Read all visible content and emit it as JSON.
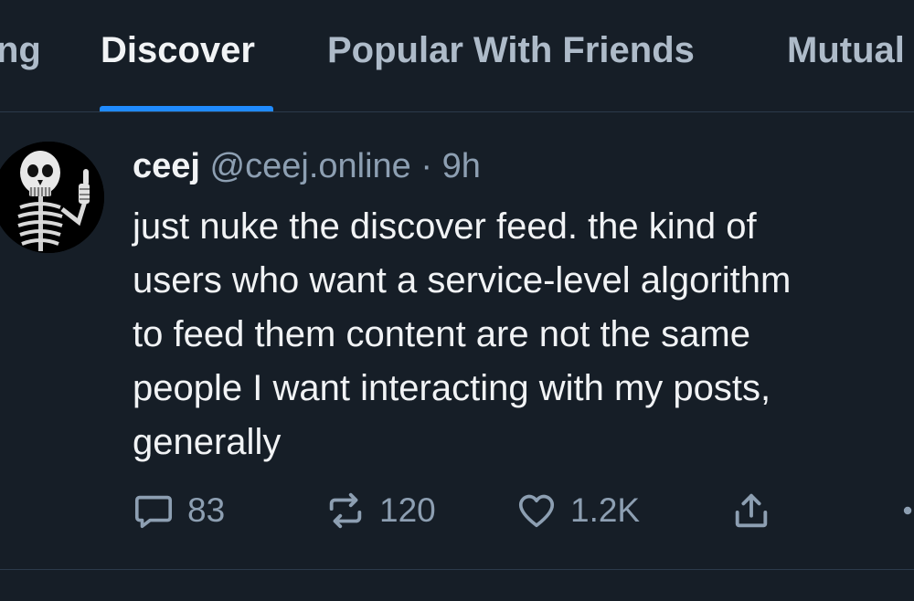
{
  "tabs": [
    {
      "label": "ng",
      "active": false
    },
    {
      "label": "Discover",
      "active": true
    },
    {
      "label": "Popular With Friends",
      "active": false
    },
    {
      "label": "Mutual",
      "active": false
    }
  ],
  "post": {
    "author_name": "ceej",
    "author_handle": "@ceej.online",
    "separator": "·",
    "time": "9h",
    "text_lines": [
      "just nuke the discover feed. the kind of",
      "users who want a service-level algorithm",
      "to feed them content are not the same",
      "people I want interacting with my posts,",
      "generally"
    ],
    "actions": {
      "reply": {
        "icon": "reply-bubble-icon",
        "count": "83"
      },
      "repost": {
        "icon": "repost-icon",
        "count": "120"
      },
      "like": {
        "icon": "heart-icon",
        "count": "1.2K"
      },
      "share": {
        "icon": "share-icon"
      },
      "more": {
        "icon": "more-dots-icon"
      }
    }
  },
  "colors": {
    "background": "#161e27",
    "accent": "#208bfe",
    "muted_text": "#8d9fb2",
    "divider": "#2c3a4b"
  }
}
